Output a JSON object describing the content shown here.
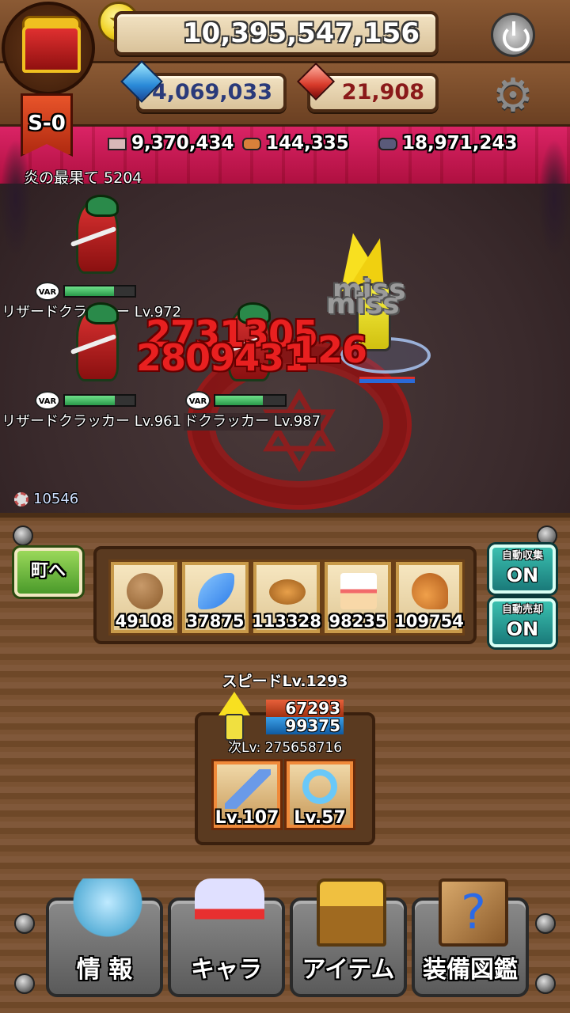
{
  "header": {
    "gold": "10,395,547,156",
    "gems": "4,069,033",
    "rubies": "21,908",
    "stage_badge": "S-0"
  },
  "resources": [
    {
      "icon": "stone-icon",
      "value": "9,370,434"
    },
    {
      "icon": "wood-icon",
      "value": "144,335"
    },
    {
      "icon": "ore-icon",
      "value": "18,971,243"
    }
  ],
  "battle": {
    "stage_name": "炎の最果て 5204",
    "enemies": [
      {
        "name": "リザードクラッカー Lv.972",
        "badge": "VAR",
        "hp": 0.7
      },
      {
        "name": "リザードクラッカー Lv.961",
        "badge": "VAR",
        "hp": 0.72
      },
      {
        "name": "ドクラッカー Lv.987",
        "badge": "VAR",
        "hp": 0.68
      }
    ],
    "damage_numbers": [
      "2731305",
      "2809431",
      "126"
    ],
    "miss_texts": [
      "miss",
      "miss"
    ],
    "kill_count": "10546"
  },
  "items": [
    {
      "icon": "potato-icon",
      "qty": "49108",
      "color": "#8a5a2a"
    },
    {
      "icon": "feather-icon",
      "qty": "37875",
      "color": "#2a7ae8"
    },
    {
      "icon": "bread-icon",
      "qty": "113328",
      "color": "#c8782a"
    },
    {
      "icon": "cake-icon",
      "qty": "98235",
      "color": "#f8c8c8"
    },
    {
      "icon": "meat-icon",
      "qty": "109754",
      "color": "#e89a3a"
    }
  ],
  "controls": {
    "town_button": "町へ",
    "auto_collect_label": "自動収集",
    "auto_collect_value": "ON",
    "auto_sell_label": "自動売却",
    "auto_sell_value": "ON"
  },
  "character": {
    "name": "スピードLv.1293",
    "atk": "67293",
    "def": "99375",
    "next_lv": "次Lv: 275658716",
    "equipment": [
      {
        "icon": "sword-icon",
        "level": "Lv.107"
      },
      {
        "icon": "ring-icon",
        "level": "Lv.57"
      }
    ]
  },
  "nav": [
    {
      "icon": "info-icon",
      "label": "情 報"
    },
    {
      "icon": "chara-icon",
      "label": "キャラ"
    },
    {
      "icon": "item-chest-icon",
      "label": "アイテム"
    },
    {
      "icon": "book-icon",
      "label": "装備図鑑"
    }
  ]
}
